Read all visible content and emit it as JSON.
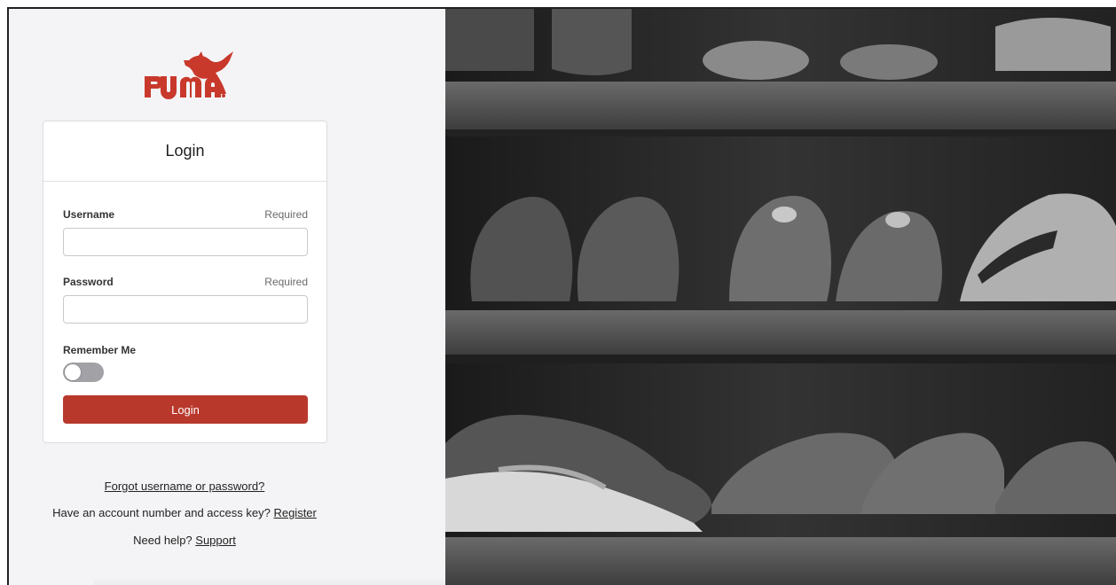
{
  "brand": {
    "name": "PUMA",
    "color": "#b9382c"
  },
  "login_card": {
    "title": "Login",
    "username": {
      "label": "Username",
      "required_text": "Required",
      "value": "",
      "placeholder": ""
    },
    "password": {
      "label": "Password",
      "required_text": "Required",
      "value": "",
      "placeholder": ""
    },
    "remember_me": {
      "label": "Remember Me",
      "checked": false
    },
    "submit_label": "Login"
  },
  "links": {
    "forgot": "Forgot username or password?",
    "register_prompt": "Have an account number and access key?",
    "register_link": "Register",
    "help_prompt": "Need help?",
    "support_link": "Support"
  },
  "background_image": {
    "icon": "shoe-shelf-photo"
  },
  "colors": {
    "panel_bg": "#f4f4f6",
    "button": "#b9382c",
    "photo_tint": "#2a2a2a"
  }
}
